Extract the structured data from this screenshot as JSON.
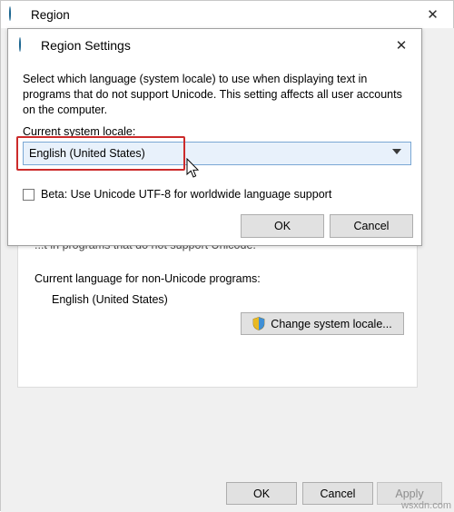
{
  "region_window": {
    "title": "Region",
    "title_icon": "globe-icon",
    "close_label": "✕",
    "occluded_text": "...t in programs that do not support Unicode.",
    "language_label": "Current language for non-Unicode programs:",
    "language_value": "English (United States)",
    "change_locale_button": "Change system locale...",
    "buttons": {
      "ok": "OK",
      "cancel": "Cancel",
      "apply": "Apply"
    },
    "watermark": "wsxdn.com"
  },
  "dialog": {
    "title": "Region Settings",
    "title_icon": "globe-icon",
    "close_label": "✕",
    "description": "Select which language (system locale) to use when displaying text in programs that do not support Unicode. This setting affects all user accounts on the computer.",
    "locale_label": "Current system locale:",
    "locale_value": "English (United States)",
    "checkbox_label": "Beta: Use Unicode UTF-8 for worldwide language support",
    "checkbox_checked": false,
    "buttons": {
      "ok": "OK",
      "cancel": "Cancel"
    },
    "highlight_color": "#cc2b2b",
    "combo_fill": "#e8f1fb",
    "combo_border": "#7aa7d4"
  }
}
